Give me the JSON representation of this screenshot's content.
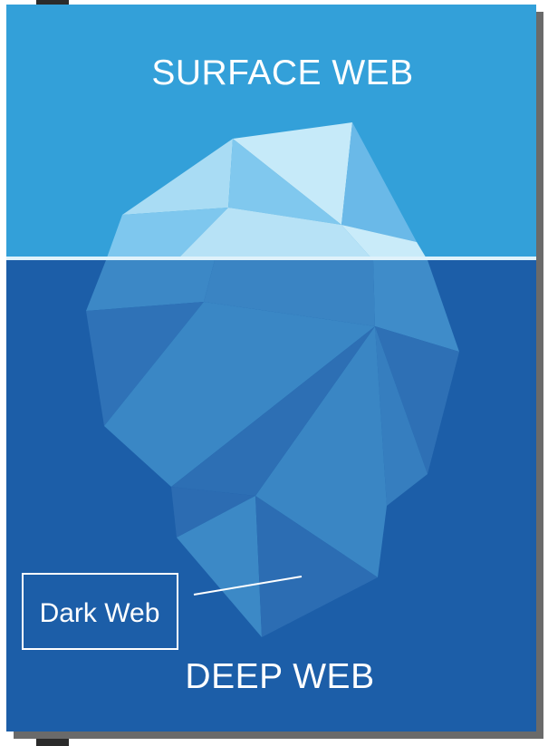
{
  "diagram": {
    "top_label": "SURFACE WEB",
    "bottom_label": "DEEP WEB",
    "callout_label": "Dark Web"
  },
  "colors": {
    "sky": "#33a0d9",
    "deep": "#1c5ea8",
    "waterline": "#dff2fb",
    "ice_light": "#b5e1f6",
    "ice_mid": "#8bcdf0",
    "ice_dark": "#62b5e6"
  }
}
